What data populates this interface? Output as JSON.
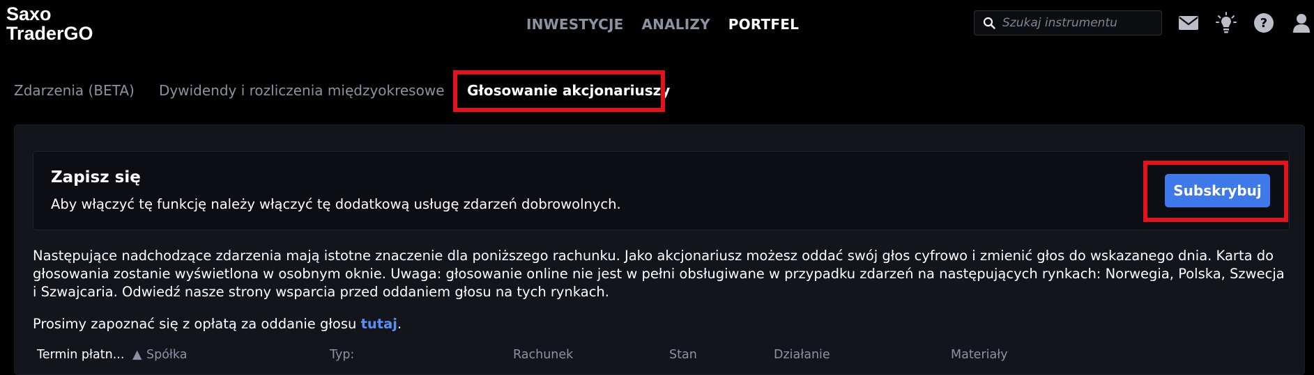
{
  "app": {
    "logo_line1": "Saxo",
    "logo_line2": "TraderGO"
  },
  "nav": {
    "items": [
      {
        "label": "INWESTYCJE",
        "active": false
      },
      {
        "label": "ANALIZY",
        "active": false
      },
      {
        "label": "PORTFEL",
        "active": true
      }
    ]
  },
  "search": {
    "placeholder": "Szukaj instrumentu",
    "value": ""
  },
  "header_icons": [
    "mail-icon",
    "lightbulb-icon",
    "help-icon",
    "user-icon"
  ],
  "subtabs": {
    "items": [
      {
        "label": "Zdarzenia (BETA)",
        "active": false
      },
      {
        "label": "Dywidendy i rozliczenia międzyokresowe",
        "active": false
      },
      {
        "label": "Głosowanie akcjonariuszy",
        "active": true
      }
    ]
  },
  "signup": {
    "title": "Zapisz się",
    "text": "Aby włączyć tę funkcję należy włączyć tę dodatkową usługę zdarzeń dobrowolnych.",
    "button": "Subskrybuj"
  },
  "info": {
    "paragraph": "Następujące nadchodzące zdarzenia mają istotne znaczenie dla poniższego rachunku. Jako akcjonariusz możesz oddać swój głos cyfrowo i zmienić głos do wskazanego dnia. Karta do głosowania zostanie wyświetlona w osobnym oknie. Uwaga: głosowanie online nie jest w pełni obsługiwane w przypadku zdarzeń na następujących rynkach: Norwegia, Polska, Szwecja i Szwajcaria. Odwiedź nasze strony wsparcia przed oddaniem głosu na tych rynkach.",
    "fee_prefix": "Prosimy zapoznać się z opłatą za oddanie głosu ",
    "fee_link": "tutaj",
    "fee_suffix": "."
  },
  "table": {
    "columns": [
      "Termin płatn...",
      "Spółka",
      "Typ:",
      "Rachunek",
      "Stan",
      "Działanie",
      "Materiały"
    ],
    "sort_indicator": "▲"
  },
  "colors": {
    "background": "#000000",
    "panel": "#12151c",
    "accent_button": "#3f78e8",
    "link": "#5b8ff5",
    "highlight": "#e3131b",
    "muted_text": "#8b93a3"
  }
}
